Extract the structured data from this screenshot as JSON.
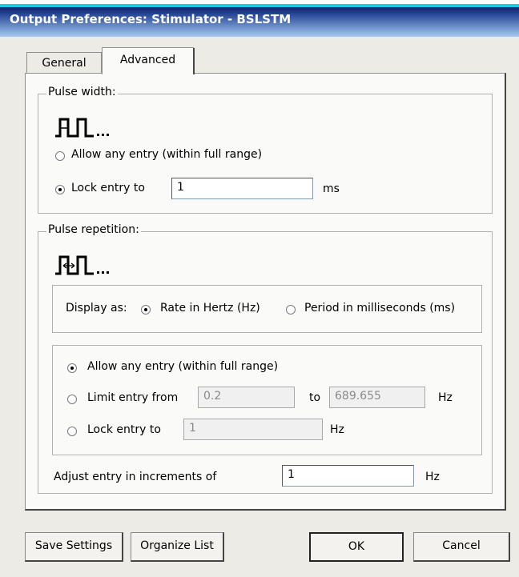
{
  "window": {
    "title": "Output Preferences: Stimulator - BSLSTM"
  },
  "tabs": [
    {
      "label": "General"
    },
    {
      "label": "Advanced"
    }
  ],
  "pulse_width": {
    "group_label": "Pulse width:",
    "allow_label": "Allow any entry (within full range)",
    "lock_label": "Lock entry to",
    "lock_value": "1",
    "unit": "ms",
    "selected": "lock"
  },
  "pulse_repetition": {
    "group_label": "Pulse repetition:",
    "display_as_label": "Display as:",
    "rate_label": "Rate in Hertz (Hz)",
    "period_label": "Period in milliseconds (ms)",
    "display_selected": "rate",
    "allow_label": "Allow any entry (within full range)",
    "limit_label": "Limit entry from",
    "limit_from": "0.2",
    "to_label": "to",
    "limit_to": "689.655",
    "limit_unit": "Hz",
    "lock_label": "Lock entry to",
    "lock_value": "1",
    "lock_unit": "Hz",
    "entry_selected": "allow",
    "increment_label": "Adjust entry in increments of",
    "increment_value": "1",
    "increment_unit": "Hz"
  },
  "buttons": {
    "save": "Save Settings",
    "organize": "Organize List",
    "ok": "OK",
    "cancel": "Cancel"
  }
}
